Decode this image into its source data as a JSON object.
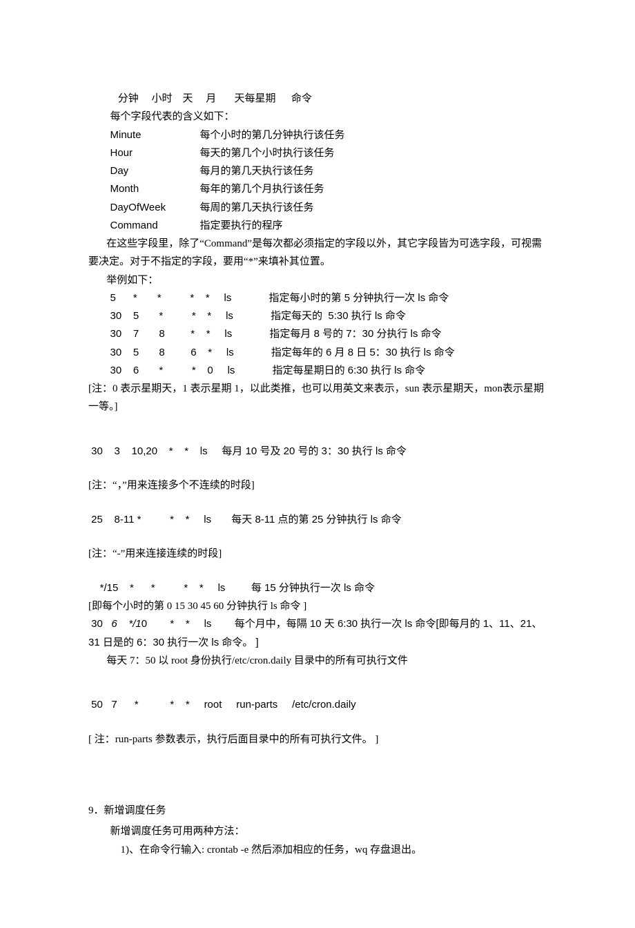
{
  "header": {
    "columns_line": "   分钟     小时    天     月       天每星期      命令",
    "meaning_intro": "每个字段代表的含义如下：",
    "fields": [
      {
        "name": "Minute",
        "desc": "每个小时的第几分钟执行该任务"
      },
      {
        "name": "Hour",
        "desc": "每天的第几个小时执行该任务"
      },
      {
        "name": "Day",
        "desc": "每月的第几天执行该任务"
      },
      {
        "name": "Month",
        "desc": "每年的第几个月执行该任务"
      },
      {
        "name": "DayOfWeek",
        "desc": "每周的第几天执行该任务"
      },
      {
        "name": "Command",
        "desc": "指定要执行的程序"
      }
    ],
    "note_part1": "       在这些字段里，除了“Command”是每次都必须指定的字段以外，其它字段皆为可选字段，可视需要决定。对于不指定的字段，要用“*”来填补其位置。",
    "examples_intro": "       举例如下："
  },
  "examples": [
    {
      "cols": "5      *       *          *    *     ls             指定每小时的第 5 分钟执行一次 ls 命令"
    },
    {
      "cols": "30    5       *          *    *     ls             指定每天的  5:30 执行 ls 命令"
    },
    {
      "cols": "30    7       8         *    *     ls             指定每月 8 号的 7：30 分执行 ls 命令"
    },
    {
      "cols": "30    5       8         6    *     ls             指定每年的 6 月 8 日 5：30 执行 ls 命令"
    },
    {
      "cols": "30    6       *          *    0     ls             指定每星期日的 6:30 执行 ls 命令"
    }
  ],
  "example_note": "[注：0 表示星期天，1 表示星期 1，以此类推，也可以用英文来表示，sun 表示星期天，mon表示星期一等。]",
  "example6": " 30    3    10,20    *    *    ls     每月 10 号及 20 号的 3：30 执行 ls 命令",
  "note6": "[注：“，”用来连接多个不连续的时段]",
  "example7": " 25    8-11 *          *    *     ls       每天 8-11 点的第 25 分钟执行 ls 命令",
  "note7": "[注：“-”用来连接连续的时段]",
  "example8": "    */15    *      *          *    *     ls         每 15 分钟执行一次 ls 命令",
  "note8": "[即每个小时的第 0 15 30 45 60 分钟执行 ls 命令 ]",
  "example9_pre": " 30   ",
  "example9_italic1": "6",
  "example9_mid": "    ",
  "example9_italic2": "*/1",
  "example9_post": "0        *    *     ls        每个月中，每隔 10 天 6:30 执行一次 ls 命令[即每月的 1、11、21、31 日是的 6：30 执行一次 ls  命令。 ]",
  "daily_note": "       每天 7：50 以 root  身份执行/etc/cron.daily 目录中的所有可执行文件",
  "example10": " 50   7      *           *    *     root     run-parts     /etc/cron.daily",
  "note10": "[  注：run-parts 参数表示，执行后面目录中的所有可执行文件。  ]",
  "section9": {
    "title": "9．新增调度任务",
    "intro": "新增调度任务可用两种方法：",
    "method1": "1)、在命令行输入: crontab -e  然后添加相应的任务，wq 存盘退出。"
  }
}
